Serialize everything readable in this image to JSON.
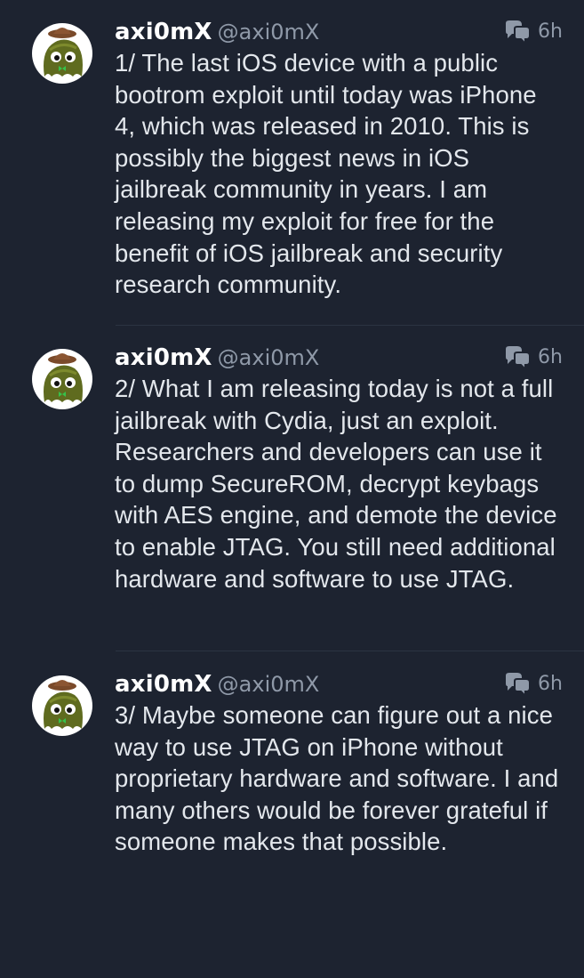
{
  "tweets": [
    {
      "display_name": "axi0mX",
      "handle": "@axi0mX",
      "time": "6h",
      "text": "1/ The last iOS device with a public bootrom exploit until today was iPhone 4, which was released in 2010. This is possibly the biggest news in iOS jailbreak community in years. I am releasing my exploit for free for the benefit of iOS jailbreak and security research community."
    },
    {
      "display_name": "axi0mX",
      "handle": "@axi0mX",
      "time": "6h",
      "text": "2/ What I am releasing today is not a full jailbreak with Cydia, just an exploit. Researchers and developers can use it to dump SecureROM, decrypt keybags with AES engine, and demote the device to enable JTAG. You still need additional hardware and software to use JTAG."
    },
    {
      "display_name": "axi0mX",
      "handle": "@axi0mX",
      "time": "6h",
      "text": "3/ Maybe someone can figure out a nice way to use JTAG on iPhone without proprietary hardware and software. I and many others would be forever grateful if someone makes that possible."
    }
  ],
  "icons": {
    "conversation": "conversation-icon",
    "avatar": "avatar-icon"
  },
  "colors": {
    "background": "#1d2330",
    "name": "#ffffff",
    "secondary": "#8f99a8",
    "body": "#e3e7ec"
  }
}
